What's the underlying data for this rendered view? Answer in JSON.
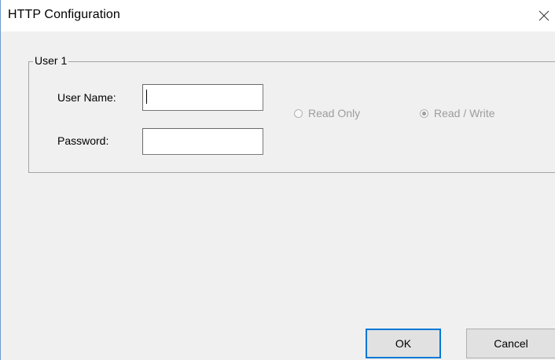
{
  "window": {
    "title": "HTTP Configuration"
  },
  "icons": {
    "close": "close-icon"
  },
  "group": {
    "legend": "User 1",
    "username_label": "User Name:",
    "password_label": "Password:",
    "username_value": "",
    "password_value": ""
  },
  "access": {
    "read_only_label": "Read Only",
    "read_write_label": "Read / Write",
    "selected": "Read / Write",
    "enabled": false
  },
  "buttons": {
    "ok_label": "OK",
    "cancel_label": "Cancel"
  },
  "colors": {
    "dialog_bg": "#f0f0f0",
    "title_bg": "#ffffff",
    "accent_border": "#0078d7",
    "disabled_text": "#9d9d9d"
  }
}
